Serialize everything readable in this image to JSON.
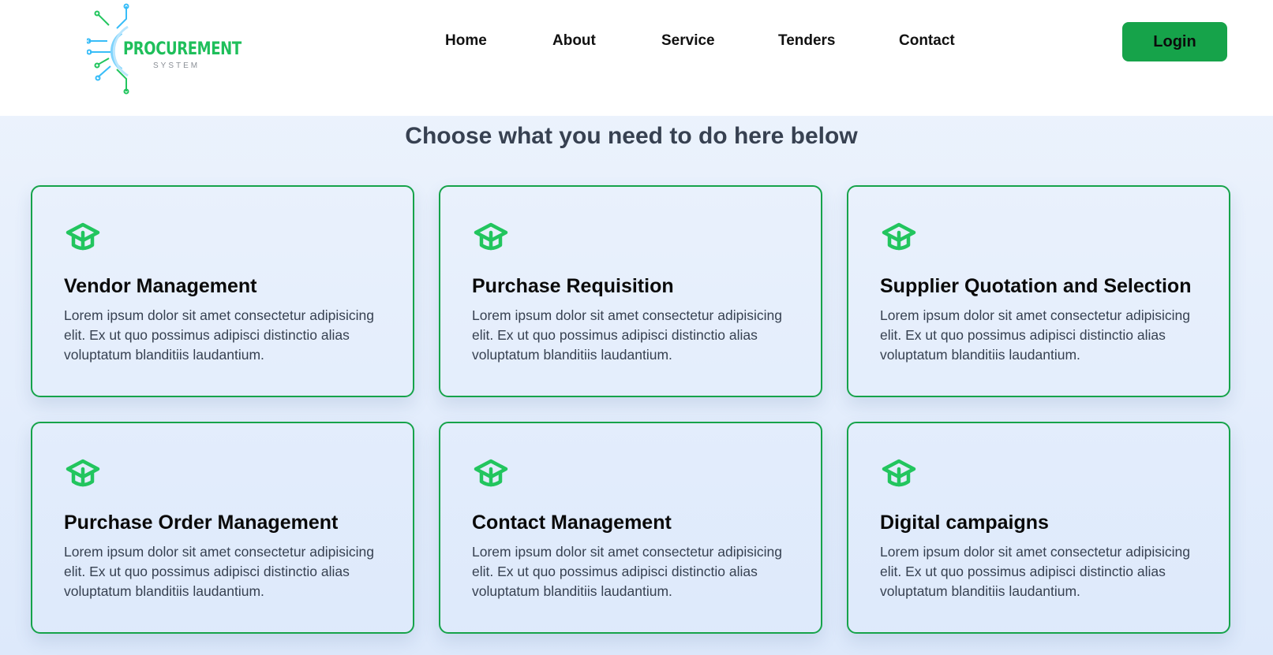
{
  "brand": {
    "name": "PROCUREMENT",
    "subtitle": "SYSTEM"
  },
  "nav": {
    "items": [
      {
        "label": "Home"
      },
      {
        "label": "About"
      },
      {
        "label": "Service"
      },
      {
        "label": "Tenders"
      },
      {
        "label": "Contact"
      }
    ],
    "login_label": "Login"
  },
  "headline": "Choose what you need to do here below",
  "cards": [
    {
      "icon": "graduation-cap-icon",
      "title": "Vendor Management",
      "description": "Lorem ipsum dolor sit amet consectetur adipisicing elit. Ex ut quo possimus adipisci distinctio alias voluptatum blanditiis laudantium."
    },
    {
      "icon": "graduation-cap-icon",
      "title": "Purchase Requisition",
      "description": "Lorem ipsum dolor sit amet consectetur adipisicing elit. Ex ut quo possimus adipisci distinctio alias voluptatum blanditiis laudantium."
    },
    {
      "icon": "graduation-cap-icon",
      "title": "Supplier Quotation and Selection",
      "description": "Lorem ipsum dolor sit amet consectetur adipisicing elit. Ex ut quo possimus adipisci distinctio alias voluptatum blanditiis laudantium."
    },
    {
      "icon": "graduation-cap-icon",
      "title": "Purchase Order Management",
      "description": "Lorem ipsum dolor sit amet consectetur adipisicing elit. Ex ut quo possimus adipisci distinctio alias voluptatum blanditiis laudantium."
    },
    {
      "icon": "graduation-cap-icon",
      "title": "Contact Management",
      "description": "Lorem ipsum dolor sit amet consectetur adipisicing elit. Ex ut quo possimus adipisci distinctio alias voluptatum blanditiis laudantium."
    },
    {
      "icon": "graduation-cap-icon",
      "title": "Digital campaigns",
      "description": "Lorem ipsum dolor sit amet consectetur adipisicing elit. Ex ut quo possimus adipisci distinctio alias voluptatum blanditiis laudantium."
    }
  ],
  "colors": {
    "accent": "#16a34a",
    "icon": "#22c55e",
    "logo_circuit": "#38bdf8"
  }
}
